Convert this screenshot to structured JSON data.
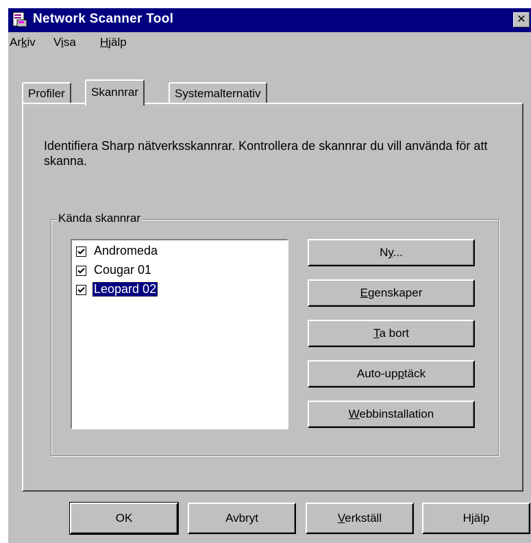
{
  "window": {
    "title": "Network Scanner Tool",
    "close_glyph": "✕"
  },
  "menu": [
    {
      "pre": "Ar",
      "key": "k",
      "post": "iv"
    },
    {
      "pre": "V",
      "key": "i",
      "post": "sa"
    },
    {
      "pre": "",
      "key": "H",
      "post": "jälp"
    }
  ],
  "tabs": [
    {
      "label": "Profiler",
      "active": false
    },
    {
      "label": "Skannrar",
      "active": true
    },
    {
      "label": "Systemalternativ",
      "active": false
    }
  ],
  "intro_text": "Identifiera Sharp nätverksskannrar.  Kontrollera de skannrar du vill använda för att skanna.",
  "group": {
    "legend": "Kända skannrar",
    "scanners": [
      {
        "name": "Andromeda",
        "checked": true,
        "selected": false
      },
      {
        "name": "Cougar 01",
        "checked": true,
        "selected": false
      },
      {
        "name": "Leopard 02",
        "checked": true,
        "selected": true
      }
    ]
  },
  "side_buttons": [
    {
      "pre": "N",
      "key": "y",
      "post": "..."
    },
    {
      "pre": "",
      "key": "E",
      "post": "genskaper"
    },
    {
      "pre": "",
      "key": "T",
      "post": "a bort"
    },
    {
      "pre": "Auto-up",
      "key": "p",
      "post": "täck"
    },
    {
      "pre": "",
      "key": "W",
      "post": "ebbinstallation"
    }
  ],
  "bottom_buttons": [
    {
      "pre": "OK",
      "key": "",
      "post": ""
    },
    {
      "pre": "Avbryt",
      "key": "",
      "post": ""
    },
    {
      "pre": "",
      "key": "V",
      "post": "erkställ"
    },
    {
      "pre": "Hjälp",
      "key": "",
      "post": ""
    }
  ],
  "colors": {
    "title_bar": "#000080",
    "face": "#c0c0c0",
    "selection": "#000080"
  },
  "icons": {
    "app": "scanner-app-icon",
    "check": "checkmark-icon"
  }
}
